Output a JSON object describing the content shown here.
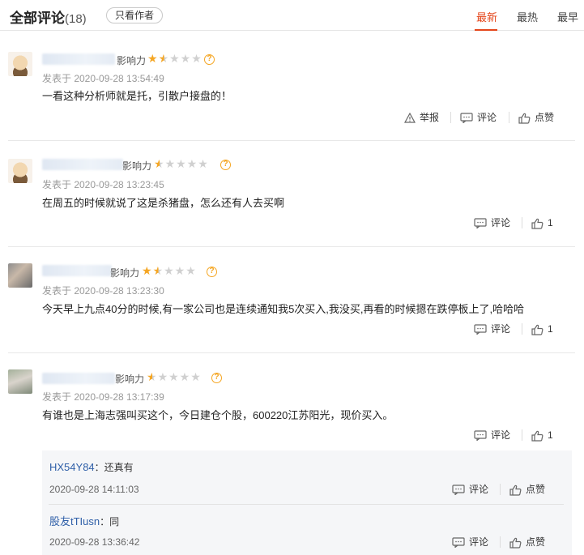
{
  "header": {
    "title": "全部评论",
    "count": "(18)",
    "author_only": "只看作者",
    "sort": [
      "最新",
      "最热",
      "最早"
    ]
  },
  "labels": {
    "influence": "影响力",
    "report": "举报",
    "comment": "评论",
    "like": "点赞"
  },
  "comments": [
    {
      "name": "一 ^",
      "rating": 2.5,
      "date": "发表于  2020-09-28 13:54:49",
      "text": "一看这种分析师就是托，引散户接盘的！",
      "likes": "点赞"
    },
    {
      "name": "",
      "rating": 1.5,
      "date": "发表于  2020-09-28 13:23:45",
      "text": "在周五的时候就说了这是杀猪盘，怎么还有人去买啊",
      "likes": "1"
    },
    {
      "name": "",
      "rating": 2.5,
      "date": "发表于  2020-09-28 13:23:30",
      "text": "今天早上九点40分的时候,有一家公司也是连续通知我5次买入,我没买,再看的时候摁在跌停板上了,哈哈哈",
      "likes": "1"
    },
    {
      "name": "股 wvi",
      "rating": 1.5,
      "date": "发表于  2020-09-28 13:17:39",
      "text": "有谁也是上海志强叫买这个，今日建仓个股，600220江苏阳光，现价买入。",
      "likes": "1"
    }
  ],
  "replies": [
    {
      "user": "HX54Y84",
      "content": "：还真有",
      "date": "2020-09-28 14:11:03"
    },
    {
      "user": "股友tTIusn",
      "content": "：同",
      "date": "2020-09-28 13:36:42"
    }
  ],
  "colors": {
    "accent": "#e4461b",
    "star": "#f5a623",
    "link": "#2f5fa8"
  },
  "icons": [
    "warning-icon",
    "comment-icon",
    "thumbs-up-icon",
    "question-icon"
  ]
}
